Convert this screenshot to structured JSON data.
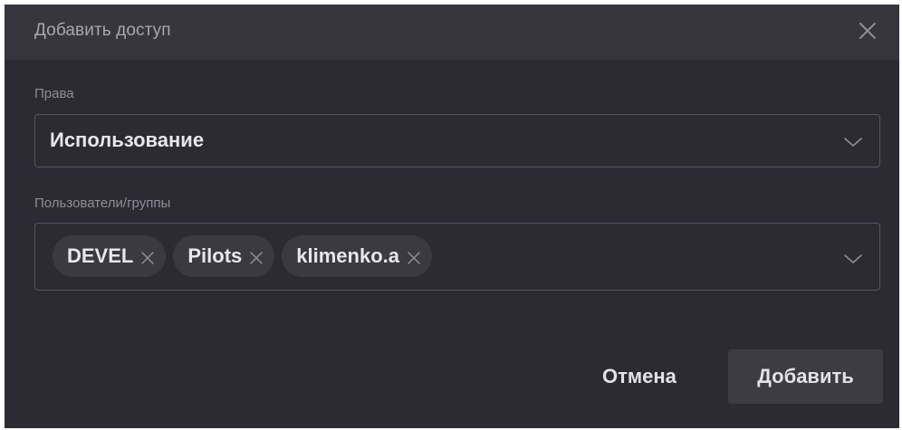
{
  "dialog": {
    "title": "Добавить доступ",
    "close_icon": "close-icon"
  },
  "rights": {
    "label": "Права",
    "value": "Использование",
    "chevron_icon": "chevron-down-icon"
  },
  "users": {
    "label": "Пользователи/группы",
    "chips": [
      "DEVEL",
      "Pilots",
      "klimenko.a"
    ],
    "chip_remove_icon": "close-icon",
    "chevron_icon": "chevron-down-icon"
  },
  "actions": {
    "cancel_label": "Отмена",
    "add_label": "Добавить"
  },
  "colors": {
    "background": "#2c2a33",
    "header": "#37353d",
    "chip": "#3b3941",
    "primary_button": "#3d3b43",
    "border": "#57555c"
  }
}
